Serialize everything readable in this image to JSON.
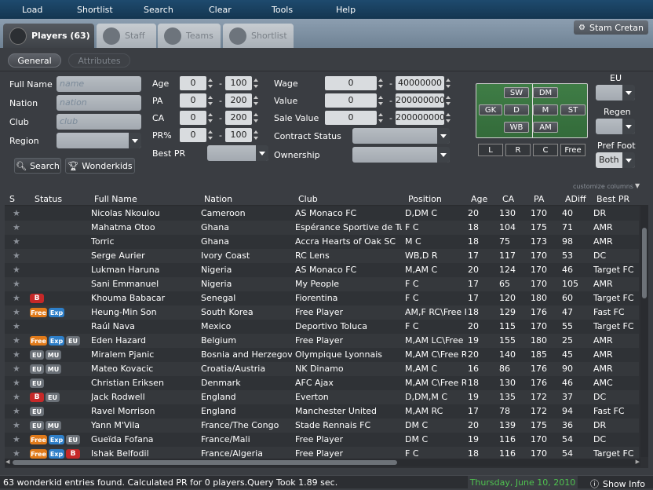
{
  "menu": [
    "Load",
    "Shortlist",
    "Search",
    "Clear",
    "Tools",
    "Help"
  ],
  "tabs": [
    {
      "label": "Players (63)",
      "active": true,
      "icon": "person-icon"
    },
    {
      "label": "Staff",
      "active": false,
      "icon": "staff-icon"
    },
    {
      "label": "Teams",
      "active": false,
      "icon": "shield-icon"
    },
    {
      "label": "Shortlist",
      "active": false,
      "icon": "clipboard-icon"
    }
  ],
  "user": "Stam Cretan",
  "subtabs": {
    "general": "General",
    "attributes": "Attributes"
  },
  "filters": {
    "full_name_label": "Full Name",
    "full_name_placeholder": "name",
    "nation_label": "Nation",
    "nation_placeholder": "nation",
    "club_label": "Club",
    "club_placeholder": "club",
    "region_label": "Region",
    "age_label": "Age",
    "age_min": "0",
    "age_max": "100",
    "pa_label": "PA",
    "pa_min": "0",
    "pa_max": "200",
    "ca_label": "CA",
    "ca_min": "0",
    "ca_max": "200",
    "pr_label": "PR%",
    "pr_min": "0",
    "pr_max": "100",
    "best_pr_label": "Best PR",
    "wage_label": "Wage",
    "wage_min": "0",
    "wage_max": "40000000",
    "value_label": "Value",
    "value_min": "0",
    "value_max": "200000000",
    "sale_value_label": "Sale Value",
    "sale_min": "0",
    "sale_max": "200000000",
    "contract_label": "Contract Status",
    "ownership_label": "Ownership",
    "eu_label": "EU",
    "regen_label": "Regen",
    "pref_foot_label": "Pref Foot",
    "pref_foot_value": "Both",
    "search_button": "Search",
    "wonderkids_button": "Wonderkids"
  },
  "pitch": {
    "positions": [
      "SW",
      "DM",
      "GK",
      "D",
      "M",
      "ST",
      "WB",
      "AM"
    ],
    "sides": [
      "L",
      "R",
      "C",
      "Free"
    ]
  },
  "customize": "customize columns",
  "columns": [
    "S",
    "Status",
    "Full Name",
    "Nation",
    "Club",
    "Position",
    "Age",
    "CA",
    "PA",
    "ADiff",
    "Best PR"
  ],
  "rows": [
    {
      "badges": [],
      "name": "Nicolas Nkoulou",
      "nation": "Cameroon",
      "club": "AS Monaco FC",
      "position": "D,DM C",
      "age": "20",
      "ca": "130",
      "pa": "170",
      "adiff": "40",
      "bestpr": "DR"
    },
    {
      "badges": [],
      "name": "Mahatma Otoo",
      "nation": "Ghana",
      "club": "Espérance Sportive de Tunis",
      "position": "F C",
      "age": "18",
      "ca": "104",
      "pa": "175",
      "adiff": "71",
      "bestpr": "AMR"
    },
    {
      "badges": [],
      "name": "Torric",
      "nation": "Ghana",
      "club": "Accra Hearts of Oak SC",
      "position": "M C",
      "age": "18",
      "ca": "75",
      "pa": "173",
      "adiff": "98",
      "bestpr": "AMR"
    },
    {
      "badges": [],
      "name": "Serge Aurier",
      "nation": "Ivory Coast",
      "club": "RC Lens",
      "position": "WB,D R",
      "age": "17",
      "ca": "117",
      "pa": "170",
      "adiff": "53",
      "bestpr": "DC"
    },
    {
      "badges": [],
      "name": "Lukman Haruna",
      "nation": "Nigeria",
      "club": "AS Monaco FC",
      "position": "M,AM C",
      "age": "20",
      "ca": "124",
      "pa": "170",
      "adiff": "46",
      "bestpr": "Target FC"
    },
    {
      "badges": [],
      "name": "Sani Emmanuel",
      "nation": "Nigeria",
      "club": "My People",
      "position": "F C",
      "age": "17",
      "ca": "65",
      "pa": "170",
      "adiff": "105",
      "bestpr": "AMR"
    },
    {
      "badges": [
        "B"
      ],
      "name": "Khouma Babacar",
      "nation": "Senegal",
      "club": "Fiorentina",
      "position": "F C",
      "age": "17",
      "ca": "120",
      "pa": "180",
      "adiff": "60",
      "bestpr": "Target FC"
    },
    {
      "badges": [
        "Free",
        "Exp"
      ],
      "name": "Heung-Min Son",
      "nation": "South Korea",
      "club": "Free Player",
      "position": "AM,F RC\\Free R",
      "age": "18",
      "ca": "129",
      "pa": "176",
      "adiff": "47",
      "bestpr": "Fast FC"
    },
    {
      "badges": [],
      "name": "Raúl Nava",
      "nation": "Mexico",
      "club": "Deportivo Toluca",
      "position": "F C",
      "age": "20",
      "ca": "115",
      "pa": "170",
      "adiff": "55",
      "bestpr": "Target FC"
    },
    {
      "badges": [
        "Free",
        "Exp",
        "EU"
      ],
      "name": "Eden Hazard",
      "nation": "Belgium",
      "club": "Free Player",
      "position": "M,AM LC\\Free R",
      "age": "19",
      "ca": "155",
      "pa": "180",
      "adiff": "25",
      "bestpr": "AMR"
    },
    {
      "badges": [
        "EU",
        "MU"
      ],
      "name": "Miralem Pjanic",
      "nation": "Bosnia and Herzegovina",
      "club": "Olympique Lyonnais",
      "position": "M,AM C\\Free Rc",
      "age": "20",
      "ca": "140",
      "pa": "185",
      "adiff": "45",
      "bestpr": "AMR"
    },
    {
      "badges": [
        "EU",
        "MU"
      ],
      "name": "Mateo Kovacic",
      "nation": "Croatia/Austria",
      "club": "NK Dinamo",
      "position": "M,AM C",
      "age": "16",
      "ca": "86",
      "pa": "176",
      "adiff": "90",
      "bestpr": "AMR"
    },
    {
      "badges": [
        "EU"
      ],
      "name": "Christian Eriksen",
      "nation": "Denmark",
      "club": "AFC Ajax",
      "position": "M,AM C\\Free Rc",
      "age": "18",
      "ca": "130",
      "pa": "176",
      "adiff": "46",
      "bestpr": "AMC"
    },
    {
      "badges": [
        "B",
        "EU"
      ],
      "name": "Jack Rodwell",
      "nation": "England",
      "club": "Everton",
      "position": "D,DM,M C",
      "age": "19",
      "ca": "135",
      "pa": "172",
      "adiff": "37",
      "bestpr": "DC"
    },
    {
      "badges": [
        "EU"
      ],
      "name": "Ravel Morrison",
      "nation": "England",
      "club": "Manchester United",
      "position": "M,AM RC",
      "age": "17",
      "ca": "78",
      "pa": "172",
      "adiff": "94",
      "bestpr": "Fast FC"
    },
    {
      "badges": [
        "EU",
        "MU"
      ],
      "name": "Yann M'Vila",
      "nation": "France/The Congo",
      "club": "Stade Rennais FC",
      "position": "DM C",
      "age": "20",
      "ca": "139",
      "pa": "175",
      "adiff": "36",
      "bestpr": "DR"
    },
    {
      "badges": [
        "Free",
        "Exp",
        "EU"
      ],
      "name": "Gueïda Fofana",
      "nation": "France/Mali",
      "club": "Free Player",
      "position": "DM C",
      "age": "19",
      "ca": "116",
      "pa": "170",
      "adiff": "54",
      "bestpr": "DC"
    },
    {
      "badges": [
        "Free",
        "Exp",
        "B"
      ],
      "name": "Ishak Belfodil",
      "nation": "France/Algeria",
      "club": "Free Player",
      "position": "F C",
      "age": "18",
      "ca": "116",
      "pa": "170",
      "adiff": "54",
      "bestpr": "Target FC"
    }
  ],
  "status_text": "63 wonderkid entries found. Calculated PR for 0 players.Query Took 1.89 sec.",
  "date": "Thursday, June 10, 2010",
  "show_info": "Show Info",
  "colors": {
    "menubar": "#1a4263",
    "date_green": "#4fc24f",
    "badge_free": "#e07a1a",
    "badge_exp": "#2e7fc9",
    "badge_b": "#c62828"
  }
}
